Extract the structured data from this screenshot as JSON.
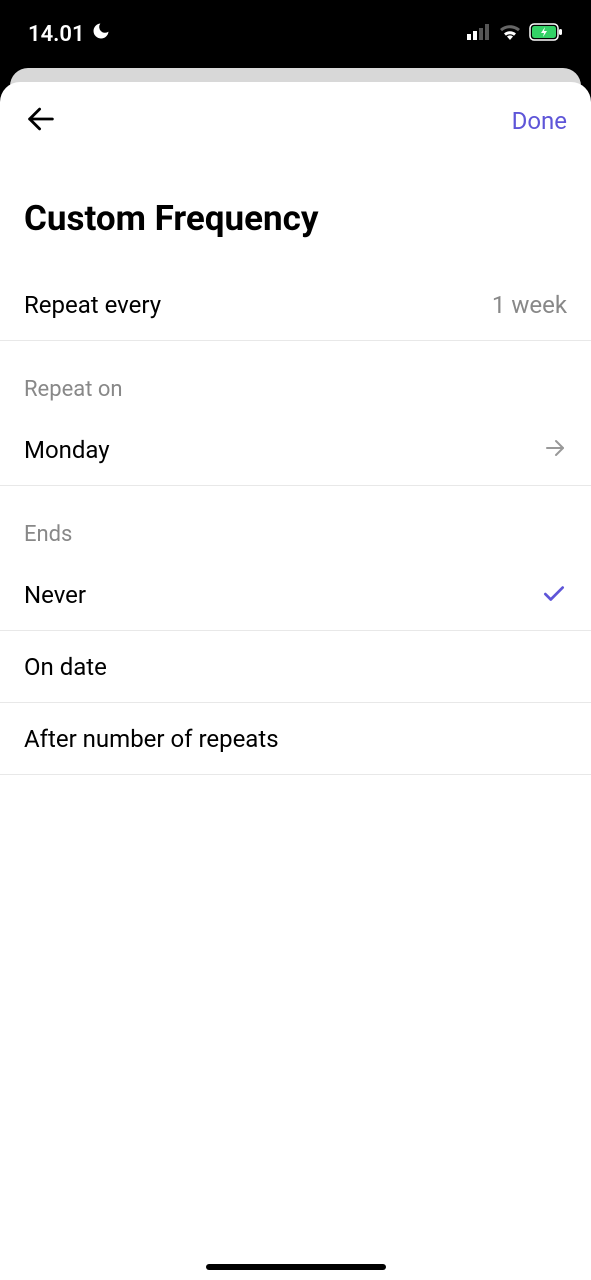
{
  "statusBar": {
    "time": "14.01"
  },
  "nav": {
    "done": "Done"
  },
  "title": "Custom Frequency",
  "repeatEvery": {
    "label": "Repeat every",
    "value": "1 week"
  },
  "repeatOn": {
    "header": "Repeat on",
    "value": "Monday"
  },
  "ends": {
    "header": "Ends",
    "options": [
      {
        "label": "Never",
        "selected": true
      },
      {
        "label": "On date",
        "selected": false
      },
      {
        "label": "After number of repeats",
        "selected": false
      }
    ]
  }
}
